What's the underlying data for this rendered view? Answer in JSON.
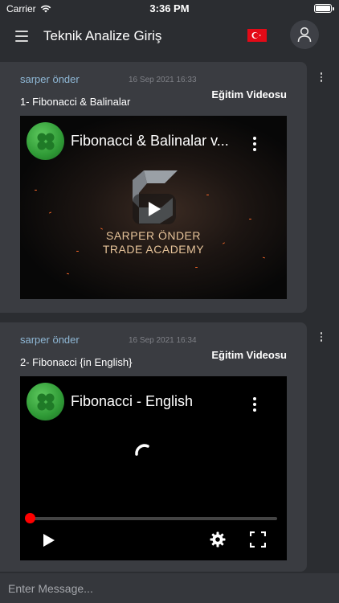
{
  "status_bar": {
    "carrier": "Carrier",
    "time": "3:36 PM",
    "wifi_icon": "wifi-icon",
    "battery_level": 1.0
  },
  "header": {
    "title": "Teknik Analize Giriş",
    "menu_icon": "hamburger-menu-icon",
    "flag_icon": "turkish-flag-icon",
    "profile_icon": "user-icon"
  },
  "posts": [
    {
      "author": "sarper önder",
      "date": "16 Sep 2021 16:33",
      "category": "Eğitim Videosu",
      "text": "1- Fibonacci & Balinalar",
      "video": {
        "title": "Fibonacci & Balinalar v...",
        "brand_line_1": "SARPER ÖNDER",
        "brand_line_2": "TRADE ACADEMY"
      }
    },
    {
      "author": "sarper önder",
      "date": "16 Sep 2021 16:34",
      "category": "Eğitim Videosu",
      "text": "2- Fibonacci {in English}",
      "video": {
        "title": "Fibonacci - English",
        "progress": 0
      }
    }
  ],
  "composer": {
    "placeholder": "Enter Message..."
  },
  "colors": {
    "background": "#2b2d31",
    "card": "#3a3c41",
    "author": "#8fb8d6",
    "progress_dot": "#ff0000",
    "flag_red": "#e30a17"
  }
}
